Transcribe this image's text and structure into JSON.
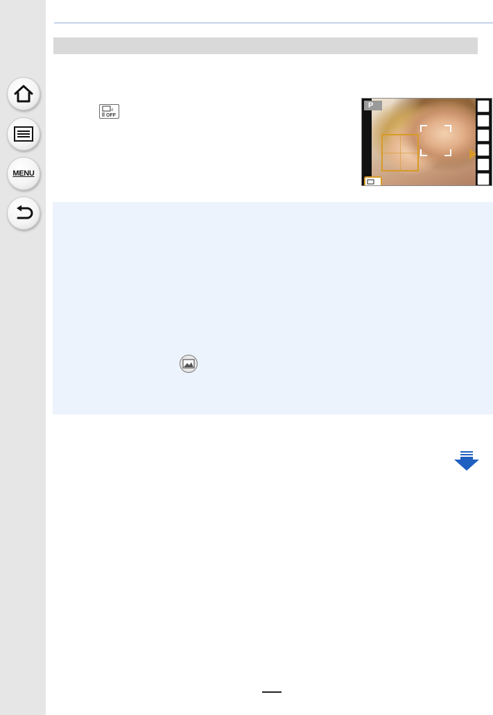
{
  "sidebar": {
    "items": [
      {
        "name": "home",
        "icon": "home-icon"
      },
      {
        "name": "contents",
        "icon": "list-icon"
      },
      {
        "name": "menu",
        "label": "MENU"
      },
      {
        "name": "back",
        "icon": "back-arrow-icon"
      }
    ]
  },
  "section": {
    "title": ""
  },
  "camera_screen": {
    "mode": "P"
  },
  "colors": {
    "sidebar_bg": "#e6e6e6",
    "info_box_bg": "#ecf3fc",
    "af_frame": "#d79a28",
    "continue_arrow": "#1f5fbf"
  }
}
